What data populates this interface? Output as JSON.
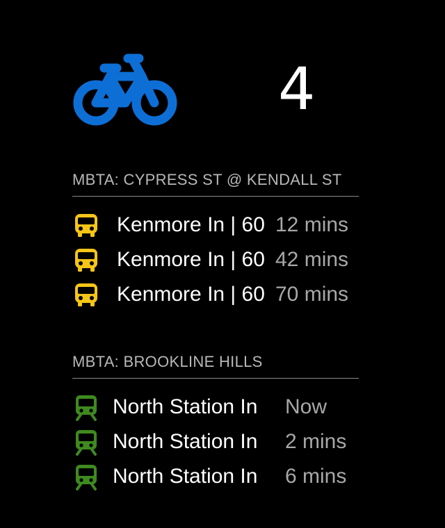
{
  "bike": {
    "icon": "bicycle-icon",
    "count": "4",
    "icon_color": "#0d6fd6"
  },
  "stops": [
    {
      "title": "MBTA: CYPRESS ST @ KENDALL ST",
      "mode": "bus",
      "icon": "bus-icon",
      "icon_color": "#f5c518",
      "predictions": [
        {
          "route": "Kenmore In | 60",
          "time": "12 mins"
        },
        {
          "route": "Kenmore In | 60",
          "time": "42 mins"
        },
        {
          "route": "Kenmore In | 60",
          "time": "70 mins"
        }
      ]
    },
    {
      "title": "MBTA: BROOKLINE HILLS",
      "mode": "light-rail",
      "icon": "train-icon",
      "icon_color": "#3f8a1f",
      "predictions": [
        {
          "route": "North Station In",
          "time": "Now"
        },
        {
          "route": "North Station In",
          "time": "2 mins"
        },
        {
          "route": "North Station In",
          "time": "6 mins"
        }
      ]
    }
  ]
}
